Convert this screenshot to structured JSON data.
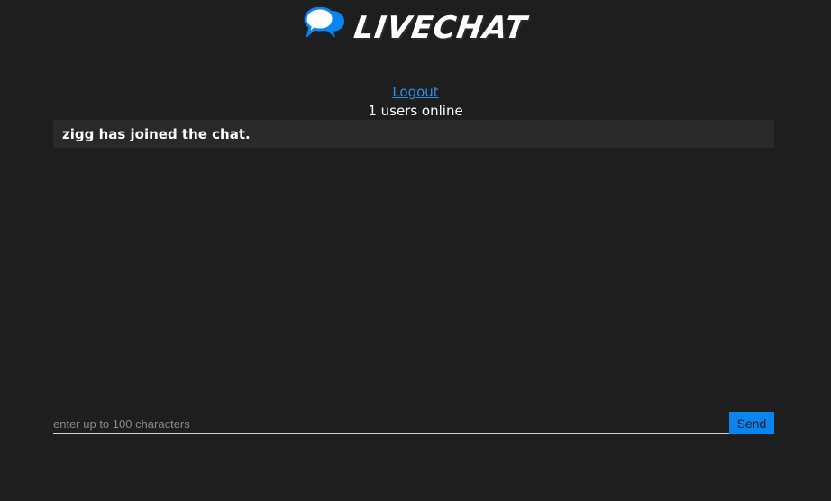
{
  "header": {
    "logo_text": "LIVECHAT",
    "logo_icon": "chat-bubbles-icon",
    "accent_color": "#0a84f0"
  },
  "session": {
    "logout_label": "Logout",
    "online_status": "1 users online"
  },
  "messages": [
    {
      "text": "zigg has joined the chat."
    }
  ],
  "composer": {
    "placeholder": "enter up to 100 characters",
    "value": "",
    "send_label": "Send"
  }
}
